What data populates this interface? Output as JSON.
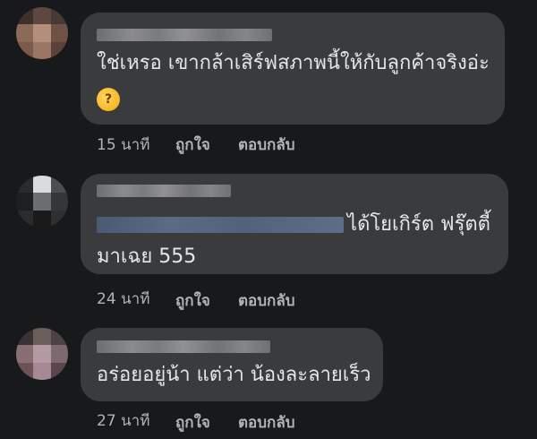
{
  "comments": [
    {
      "text": "ใช่เหรอ เขากล้าเสิร์ฟสภาพนี้ให้กับลูกค้าจริงอ่ะ",
      "emoji": "🤔",
      "time": "15 นาที",
      "like_label": "ถูกใจ",
      "reply_label": "ตอบกลับ"
    },
    {
      "text_line1": "ได้โยเกิร์ต ฟรุ๊ตตี้",
      "text_line2": "มาเฉย 555",
      "time": "24 นาที",
      "like_label": "ถูกใจ",
      "reply_label": "ตอบกลับ"
    },
    {
      "text": "อร่อยอยู่น้า แต่ว่า น้องละลายเร็ว",
      "time": "27 นาที",
      "like_label": "ถูกใจ",
      "reply_label": "ตอบกลับ"
    }
  ]
}
